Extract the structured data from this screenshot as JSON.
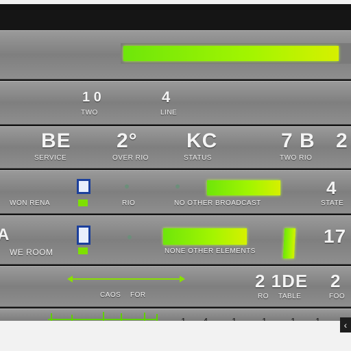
{
  "row0": {
    "progress_fill": 0.95
  },
  "row1": {
    "left_value": "1 0",
    "left_label": "TWO",
    "right_value": "4",
    "right_label": "LINE"
  },
  "row2": {
    "v1": "BE",
    "l1": "SERVICE",
    "v2": "2°",
    "l2": "OVER RIO",
    "v3": "KC",
    "l3": "STATUS",
    "v4": "7 B",
    "l4": "TWO RIO",
    "v5": "2",
    "l5": ""
  },
  "row3": {
    "label_left": "WON RENA",
    "label_mid": "RIO",
    "label_center": "NO OTHER BROADCAST",
    "value_right": "4",
    "label_right": "STATE",
    "bar_fill": 0.74
  },
  "row4": {
    "value_left": "A",
    "label_left": "WE ROOM",
    "label_center": "NONE OTHER ELEMENTS",
    "value_right": "17",
    "bar_fill": 0.64
  },
  "row5": {
    "mid_labels": [
      "CAOS",
      "FOR"
    ],
    "value_right": "2 1DE",
    "value_far": "2",
    "labels_right": [
      "RO",
      "TABLE",
      "FOO"
    ]
  },
  "row6": {
    "tick_labels": [
      "1",
      "4",
      "1",
      "1",
      "1",
      "1"
    ]
  },
  "footer": {
    "corner_icon": "chevron-left-icon",
    "corner_glyph": "‹"
  },
  "colors": {
    "accent": "#9af000",
    "panel": "#8e8e8e",
    "background": "#151515"
  }
}
